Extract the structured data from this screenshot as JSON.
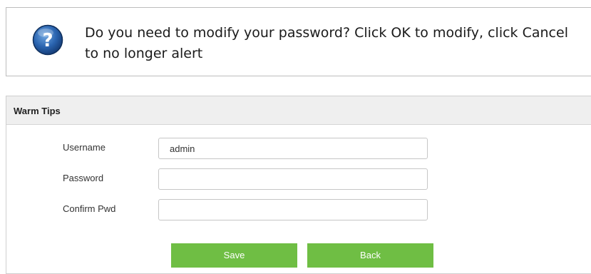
{
  "alert": {
    "icon": "question-icon",
    "icon_color": "#1f5fa8",
    "message": "Do you need to modify your password? Click OK to modify, click Cancel to no longer alert"
  },
  "panel": {
    "title": "Warm Tips",
    "fields": {
      "username": {
        "label": "Username",
        "value": "admin",
        "placeholder": ""
      },
      "password": {
        "label": "Password",
        "value": "",
        "placeholder": ""
      },
      "confirm": {
        "label": "Confirm Pwd",
        "value": "",
        "placeholder": ""
      }
    },
    "buttons": {
      "save_label": "Save",
      "back_label": "Back"
    },
    "accent_color": "#6fbe44"
  }
}
